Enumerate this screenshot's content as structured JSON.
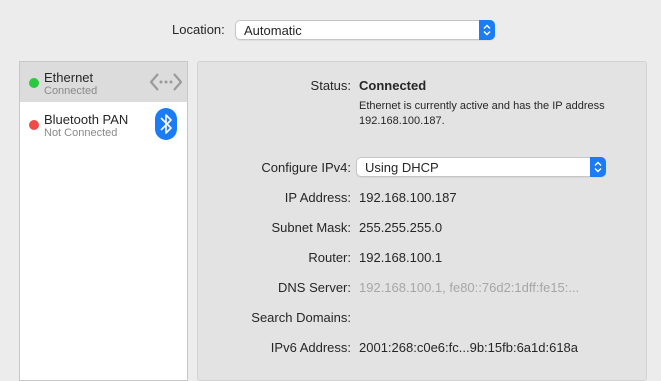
{
  "location": {
    "label": "Location:",
    "value": "Automatic"
  },
  "services": [
    {
      "name": "Ethernet",
      "status": "Connected",
      "status_color": "#27c93f",
      "icon": "ethernet-arrows-icon",
      "selected": true
    },
    {
      "name": "Bluetooth PAN",
      "status": "Not Connected",
      "status_color": "#f04b45",
      "icon": "bluetooth-icon",
      "selected": false
    }
  ],
  "detail": {
    "status_label": "Status:",
    "status_value": "Connected",
    "status_description": "Ethernet is currently active and has the IP address 192.168.100.187.",
    "configure_label": "Configure IPv4:",
    "configure_value": "Using DHCP",
    "ip_label": "IP Address:",
    "ip_value": "192.168.100.187",
    "subnet_label": "Subnet Mask:",
    "subnet_value": "255.255.255.0",
    "router_label": "Router:",
    "router_value": "192.168.100.1",
    "dns_label": "DNS Server:",
    "dns_value": "192.168.100.1, fe80::76d2:1dff:fe15:...",
    "search_label": "Search Domains:",
    "search_value": "",
    "ipv6_label": "IPv6 Address:",
    "ipv6_value": "2001:268:c0e6:fc...9b:15fb:6a1d:618a"
  },
  "colors": {
    "accent": "#1b7cf5",
    "connected": "#27c93f",
    "disconnected": "#f04b45"
  }
}
